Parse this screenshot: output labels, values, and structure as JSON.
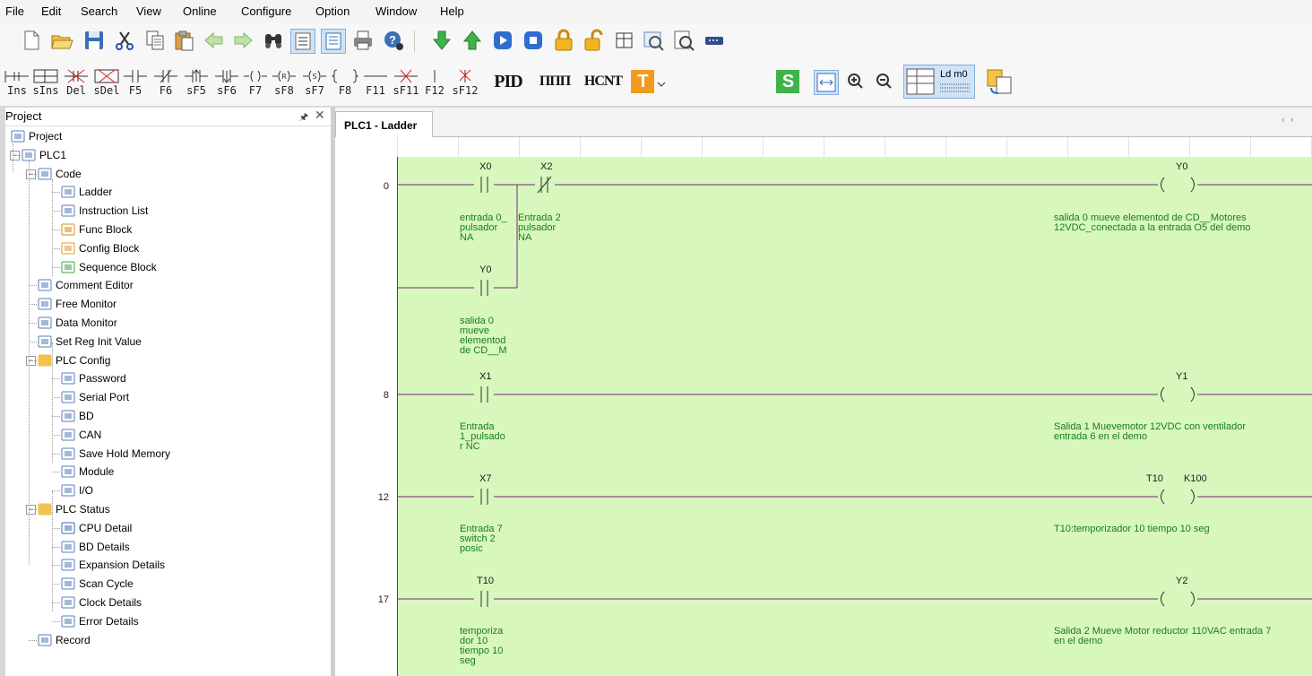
{
  "menu": [
    "File",
    "Edit",
    "Search",
    "View",
    "Online",
    "Configure",
    "Option",
    "Window",
    "Help"
  ],
  "toolbar1": {
    "icons": [
      "new-file-icon",
      "open-folder-icon",
      "save-icon",
      "cut-icon",
      "copy-icon",
      "paste-icon",
      "back-arrow-icon",
      "forward-arrow-icon",
      "find-icon",
      "ladder-view-icon",
      "list-view-icon",
      "print-icon",
      "help-icon",
      "download-icon",
      "upload-icon",
      "run-icon",
      "stop-icon",
      "lock-icon",
      "unlock-icon",
      "monitor-icon",
      "compare-icon",
      "preview-icon",
      "serial-icon"
    ]
  },
  "toolbar2": {
    "keys": [
      {
        "label": "Ins",
        "name": "insert-rung"
      },
      {
        "label": "sIns",
        "name": "insert-column"
      },
      {
        "label": "Del",
        "name": "delete-rung"
      },
      {
        "label": "sDel",
        "name": "delete-column"
      },
      {
        "label": "F5",
        "name": "contact-no"
      },
      {
        "label": "F6",
        "name": "contact-nc"
      },
      {
        "label": "sF5",
        "name": "contact-rising"
      },
      {
        "label": "sF6",
        "name": "contact-falling"
      },
      {
        "label": "F7",
        "name": "coil-out"
      },
      {
        "label": "sF8",
        "name": "coil-reset"
      },
      {
        "label": "sF7",
        "name": "coil-set"
      },
      {
        "label": "F8",
        "name": "function-block"
      },
      {
        "label": "F11",
        "name": "horizontal-line"
      },
      {
        "label": "sF11",
        "name": "delete-horizontal-line"
      },
      {
        "label": "F12",
        "name": "vertical-line"
      },
      {
        "label": "sF12",
        "name": "delete-vertical-line"
      }
    ],
    "pid": "PID",
    "pwm": "ППП",
    "hcnt": "HCNT",
    "t_btn": "T",
    "s_btn": "S",
    "ldm0": "Ld m0"
  },
  "project": {
    "title": "Project",
    "tree": [
      {
        "label": "Project",
        "icon": "project-icon"
      },
      {
        "label": "PLC1",
        "icon": "plc-icon"
      },
      {
        "label": "Code",
        "icon": "code-icon"
      },
      {
        "label": "Ladder",
        "icon": "ladder-icon"
      },
      {
        "label": "Instruction List",
        "icon": "instruction-list-icon"
      },
      {
        "label": "Func Block",
        "icon": "func-block-icon"
      },
      {
        "label": "Config Block",
        "icon": "config-block-icon"
      },
      {
        "label": "Sequence Block",
        "icon": "sequence-block-icon"
      },
      {
        "label": "Comment Editor",
        "icon": "comment-editor-icon"
      },
      {
        "label": "Free Monitor",
        "icon": "free-monitor-icon"
      },
      {
        "label": "Data Monitor",
        "icon": "data-monitor-icon"
      },
      {
        "label": "Set Reg Init Value",
        "icon": "set-reg-icon"
      },
      {
        "label": "PLC Config",
        "icon": "folder-icon"
      },
      {
        "label": "Password",
        "icon": "password-icon"
      },
      {
        "label": "Serial Port",
        "icon": "serial-port-icon"
      },
      {
        "label": "BD",
        "icon": "bd-icon"
      },
      {
        "label": "CAN",
        "icon": "can-icon"
      },
      {
        "label": "Save Hold Memory",
        "icon": "hold-memory-icon"
      },
      {
        "label": "Module",
        "icon": "module-icon"
      },
      {
        "label": "I/O",
        "icon": "io-icon"
      },
      {
        "label": "PLC Status",
        "icon": "folder-icon"
      },
      {
        "label": "CPU Detail",
        "icon": "cpu-icon"
      },
      {
        "label": "BD Details",
        "icon": "bd-details-icon"
      },
      {
        "label": "Expansion Details",
        "icon": "expansion-icon"
      },
      {
        "label": "Scan Cycle",
        "icon": "scan-cycle-icon"
      },
      {
        "label": "Clock Details",
        "icon": "clock-icon"
      },
      {
        "label": "Error Details",
        "icon": "error-icon"
      },
      {
        "label": "Record",
        "icon": "record-icon"
      }
    ]
  },
  "tab": {
    "label": "PLC1 - Ladder"
  },
  "ladder": {
    "steps": [
      "0",
      "8",
      "12",
      "17"
    ],
    "contacts": [
      {
        "label": "X0",
        "type": "no"
      },
      {
        "label": "X2",
        "type": "nc"
      },
      {
        "label": "Y0",
        "type": "no"
      },
      {
        "label": "X1",
        "type": "no"
      },
      {
        "label": "X7",
        "type": "no"
      },
      {
        "label": "T10",
        "type": "no"
      }
    ],
    "coils": [
      {
        "label": "Y0"
      },
      {
        "label": "Y1"
      },
      {
        "label": "T10"
      },
      {
        "label": "Y2"
      }
    ],
    "coil_param": "K100",
    "comments": [
      {
        "text": "entrada 0_\npulsador\nNA"
      },
      {
        "text": "Entrada 2\npulsador\nNA"
      },
      {
        "text": "salida 0 mueve elementod de CD__Motores\n12VDC_conectada a la entrada O5 del demo"
      },
      {
        "text": "salida 0\nmueve\nelementod\nde CD__M"
      },
      {
        "text": "Entrada\n1_pulsado\nr NC"
      },
      {
        "text": "Salida 1 Muevemotor 12VDC con ventilador\nentrada 6 en el demo"
      },
      {
        "text": "Entrada 7\nswitch 2\nposic"
      },
      {
        "text": "T10:temporizador 10 tiempo 10 seg"
      },
      {
        "text": "temporiza\ndor 10\ntiempo 10\nseg"
      },
      {
        "text": "Salida 2 Mueve Motor reductor 110VAC entrada 7\nen el demo"
      }
    ]
  }
}
